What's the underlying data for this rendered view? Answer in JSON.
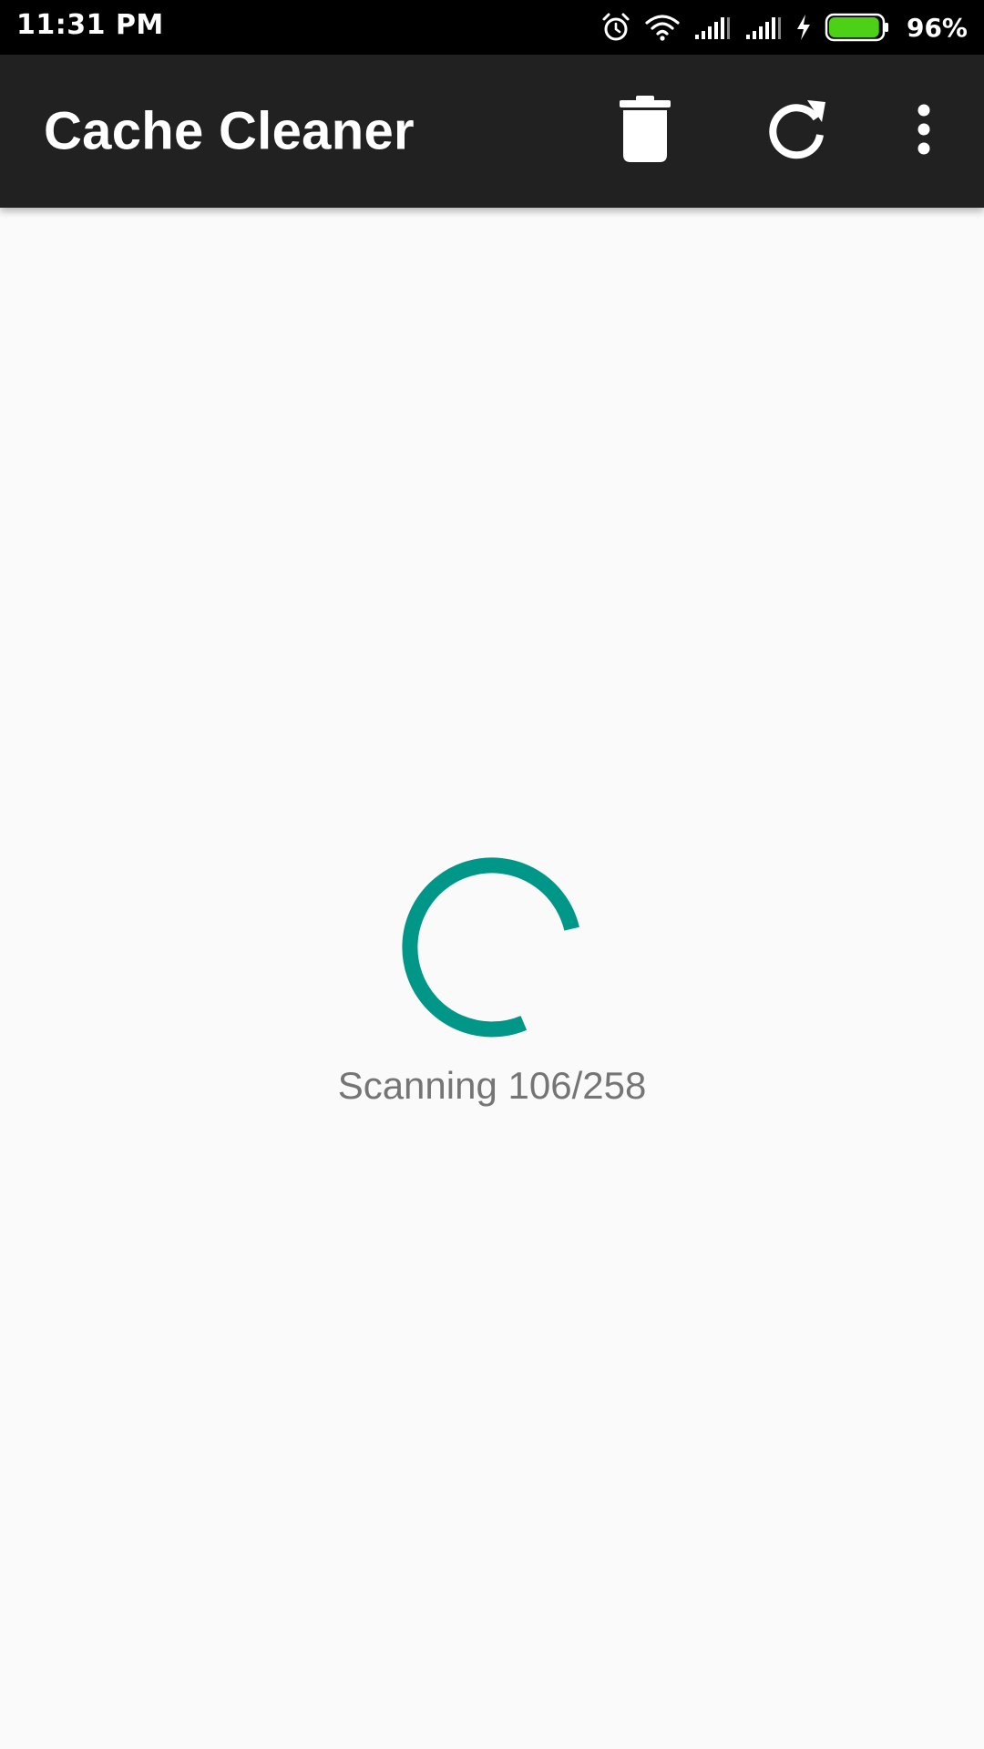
{
  "status_bar": {
    "time": "11:31 PM",
    "battery_percent": "96%",
    "battery_level": 0.96,
    "battery_color": "#4cd117",
    "icons": [
      "alarm-icon",
      "wifi-icon",
      "signal-icon",
      "signal-icon",
      "charging-icon",
      "battery-icon"
    ]
  },
  "app_bar": {
    "title": "Cache Cleaner",
    "background": "#212121",
    "actions": [
      "trash-icon",
      "refresh-icon",
      "more-vert-icon"
    ]
  },
  "main": {
    "progress_text": "Scanning 106/258",
    "spinner_color": "#009688"
  }
}
